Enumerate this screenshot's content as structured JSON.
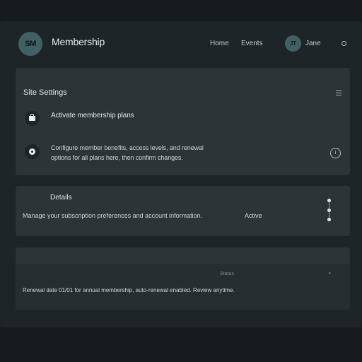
{
  "header": {
    "logo_text": "SM",
    "brand": "Membership",
    "nav": [
      "Home",
      "Events"
    ],
    "avatar_initials": "JT",
    "user_name": "Jane"
  },
  "card_main": {
    "title": "Site Settings",
    "rows": [
      {
        "icon": "bag-icon",
        "text": "Activate membership plans"
      },
      {
        "icon": "gear-icon",
        "lines": [
          "Configure member benefits, access levels, and renewal",
          "options for all plans here, then confirm changes."
        ]
      }
    ],
    "info_icon": "i"
  },
  "card_details": {
    "title": "Details",
    "text": "Manage your subscription preferences and account information.",
    "badge": "Active"
  },
  "card_table": {
    "column_label": "Status",
    "sort_glyph": "⌃",
    "text": "Renewal date 01/01 for annual membership, auto-renewal enabled. Review anytime."
  },
  "colors": {
    "background": "#1a2023",
    "card": "#2c3438",
    "accent": "#3f6163",
    "text": "#d9dee0"
  }
}
